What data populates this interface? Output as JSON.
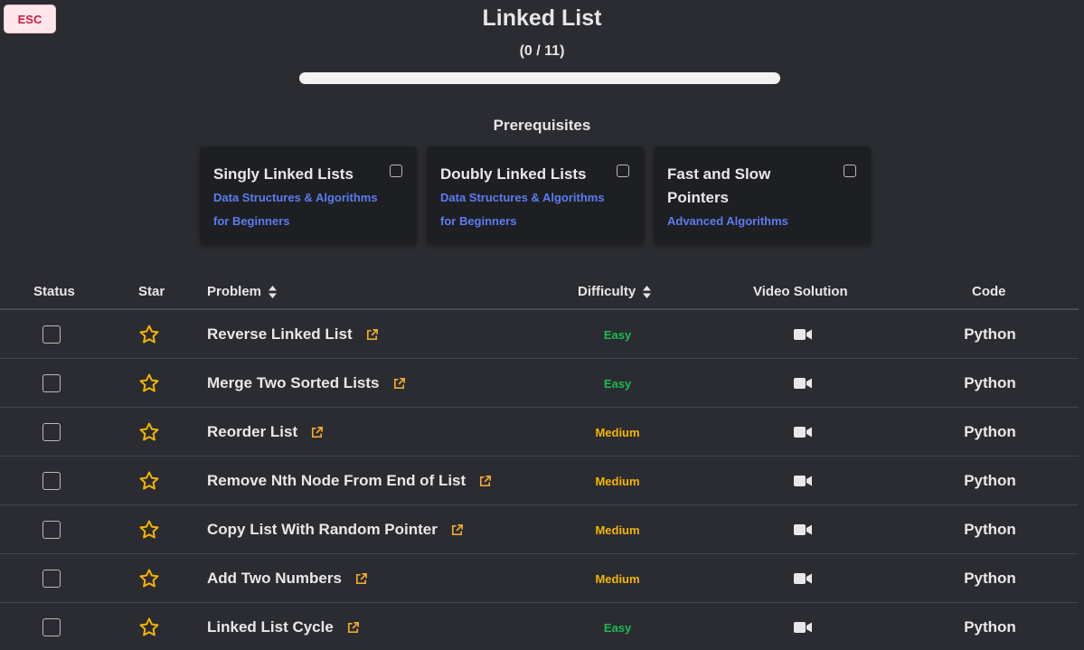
{
  "esc_label": "ESC",
  "title": "Linked List",
  "progress": {
    "text": "(0 / 11)",
    "completed": 0,
    "total": 11
  },
  "prerequisites": {
    "heading": "Prerequisites",
    "cards": [
      {
        "title": "Singly Linked Lists",
        "course": "Data Structures & Algorithms for Beginners"
      },
      {
        "title": "Doubly Linked Lists",
        "course": "Data Structures & Algorithms for Beginners"
      },
      {
        "title": "Fast and Slow Pointers",
        "course": "Advanced Algorithms"
      }
    ]
  },
  "table": {
    "headers": {
      "status": "Status",
      "star": "Star",
      "problem": "Problem",
      "difficulty": "Difficulty",
      "video": "Video Solution",
      "code": "Code"
    },
    "rows": [
      {
        "problem": "Reverse Linked List",
        "difficulty": "Easy",
        "code": "Python"
      },
      {
        "problem": "Merge Two Sorted Lists",
        "difficulty": "Easy",
        "code": "Python"
      },
      {
        "problem": "Reorder List",
        "difficulty": "Medium",
        "code": "Python"
      },
      {
        "problem": "Remove Nth Node From End of List",
        "difficulty": "Medium",
        "code": "Python"
      },
      {
        "problem": "Copy List With Random Pointer",
        "difficulty": "Medium",
        "code": "Python"
      },
      {
        "problem": "Add Two Numbers",
        "difficulty": "Medium",
        "code": "Python"
      },
      {
        "problem": "Linked List Cycle",
        "difficulty": "Easy",
        "code": "Python"
      }
    ]
  },
  "colors": {
    "easy": "#1db954",
    "medium": "#f5b400",
    "star": "#f4b400",
    "link": "#5b7cf0",
    "external_link": "#f0a830"
  },
  "icons": {
    "star": "star-outline-icon",
    "external_link": "external-link-icon",
    "video": "video-camera-icon",
    "sort": "sort-icon"
  }
}
